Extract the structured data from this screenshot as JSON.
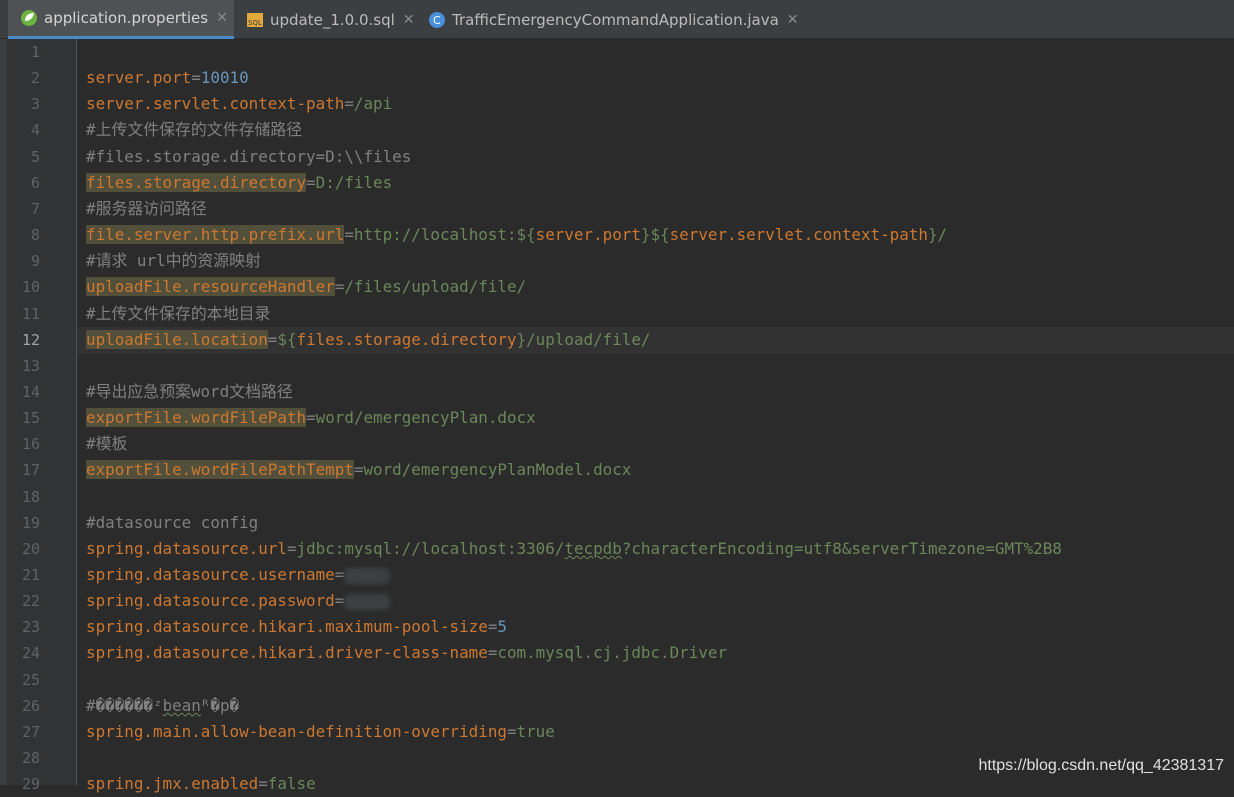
{
  "tabs": [
    {
      "label": "application.properties",
      "icon": "spring-leaf-icon",
      "active": true
    },
    {
      "label": "update_1.0.0.sql",
      "icon": "sql-file-icon",
      "active": false
    },
    {
      "label": "TrafficEmergencyCommandApplication.java",
      "icon": "java-class-icon",
      "active": false
    }
  ],
  "editor": {
    "current_line": 12,
    "line_numbers": [
      "1",
      "2",
      "3",
      "4",
      "5",
      "6",
      "7",
      "8",
      "9",
      "10",
      "11",
      "12",
      "13",
      "14",
      "15",
      "16",
      "17",
      "18",
      "19",
      "20",
      "21",
      "22",
      "23",
      "24",
      "25",
      "26",
      "27",
      "28",
      "29"
    ],
    "lines": [
      {
        "parts": []
      },
      {
        "parts": [
          {
            "t": "server.port",
            "c": "key"
          },
          {
            "t": "=",
            "c": "eq"
          },
          {
            "t": "10010",
            "c": "num"
          }
        ]
      },
      {
        "parts": [
          {
            "t": "server.servlet.context-path",
            "c": "key"
          },
          {
            "t": "=",
            "c": "eq"
          },
          {
            "t": "/api",
            "c": "val"
          }
        ]
      },
      {
        "parts": [
          {
            "t": "#上传文件保存的文件存储路径",
            "c": "com"
          }
        ]
      },
      {
        "parts": [
          {
            "t": "#files.storage.directory=D:\\\\files",
            "c": "com"
          }
        ]
      },
      {
        "parts": [
          {
            "t": "files.storage.directory",
            "c": "key hl"
          },
          {
            "t": "=",
            "c": "eq"
          },
          {
            "t": "D:/files",
            "c": "val"
          }
        ]
      },
      {
        "parts": [
          {
            "t": "#服务器访问路径",
            "c": "com"
          }
        ]
      },
      {
        "parts": [
          {
            "t": "file.server.http.prefix.url",
            "c": "key hl"
          },
          {
            "t": "=",
            "c": "eq"
          },
          {
            "t": "http://localhost:${",
            "c": "val"
          },
          {
            "t": "server.port",
            "c": "ref"
          },
          {
            "t": "}${",
            "c": "val"
          },
          {
            "t": "server.servlet.context-path",
            "c": "ref"
          },
          {
            "t": "}/",
            "c": "val"
          }
        ]
      },
      {
        "parts": [
          {
            "t": "#请求 url中的资源映射",
            "c": "com"
          }
        ]
      },
      {
        "parts": [
          {
            "t": "uploadFile.resourceHandler",
            "c": "key hl"
          },
          {
            "t": "=",
            "c": "eq"
          },
          {
            "t": "/files/upload/file/",
            "c": "val"
          }
        ]
      },
      {
        "parts": [
          {
            "t": "#上传文件保存的本地目录",
            "c": "com"
          }
        ]
      },
      {
        "parts": [
          {
            "t": "uploadFile.location",
            "c": "key hl"
          },
          {
            "t": "=",
            "c": "eq"
          },
          {
            "t": "${",
            "c": "val"
          },
          {
            "t": "files.storage.directory",
            "c": "ref"
          },
          {
            "t": "}/upload/file/",
            "c": "val"
          }
        ]
      },
      {
        "parts": []
      },
      {
        "parts": [
          {
            "t": "#导出应急预案word文档路径",
            "c": "com"
          }
        ]
      },
      {
        "parts": [
          {
            "t": "exportFile.wordFilePath",
            "c": "key hl"
          },
          {
            "t": "=",
            "c": "eq"
          },
          {
            "t": "word/emergencyPlan.docx",
            "c": "val"
          }
        ]
      },
      {
        "parts": [
          {
            "t": "#模板",
            "c": "com"
          }
        ]
      },
      {
        "parts": [
          {
            "t": "exportFile.wordFilePathTempt",
            "c": "key hl"
          },
          {
            "t": "=",
            "c": "eq"
          },
          {
            "t": "word/emergencyPlanModel.docx",
            "c": "val"
          }
        ]
      },
      {
        "parts": []
      },
      {
        "parts": [
          {
            "t": "#datasource config",
            "c": "com"
          }
        ]
      },
      {
        "parts": [
          {
            "t": "spring.datasource.url",
            "c": "key"
          },
          {
            "t": "=",
            "c": "eq"
          },
          {
            "t": "jdbc:mysql://localhost:3306/",
            "c": "val"
          },
          {
            "t": "tecpdb",
            "c": "val squig"
          },
          {
            "t": "?characterEncoding=utf8&serverTimezone=GMT%2B8",
            "c": "val"
          }
        ]
      },
      {
        "parts": [
          {
            "t": "spring.datasource.username",
            "c": "key"
          },
          {
            "t": "=",
            "c": "eq"
          },
          {
            "t": "",
            "c": "blur"
          }
        ]
      },
      {
        "parts": [
          {
            "t": "spring.datasource.password",
            "c": "key"
          },
          {
            "t": "=",
            "c": "eq"
          },
          {
            "t": "",
            "c": "blur"
          }
        ]
      },
      {
        "parts": [
          {
            "t": "spring.datasource.hikari.maximum-pool-size",
            "c": "key"
          },
          {
            "t": "=",
            "c": "eq"
          },
          {
            "t": "5",
            "c": "num"
          }
        ]
      },
      {
        "parts": [
          {
            "t": "spring.datasource.hikari.driver-class-name",
            "c": "key"
          },
          {
            "t": "=",
            "c": "eq"
          },
          {
            "t": "com.mysql.cj.jdbc.Driver",
            "c": "val"
          }
        ]
      },
      {
        "parts": []
      },
      {
        "parts": [
          {
            "t": "#������",
            "c": "com"
          },
          {
            "t": "ᶻ",
            "c": "com"
          },
          {
            "t": "bean",
            "c": "com squig"
          },
          {
            "t": "ᴿ",
            "c": "com"
          },
          {
            "t": "�p�",
            "c": "com"
          }
        ]
      },
      {
        "parts": [
          {
            "t": "spring.main.allow-bean-definition-overriding",
            "c": "key"
          },
          {
            "t": "=",
            "c": "eq"
          },
          {
            "t": "true",
            "c": "val"
          }
        ]
      },
      {
        "parts": []
      },
      {
        "parts": [
          {
            "t": "spring.jmx.enabled",
            "c": "key"
          },
          {
            "t": "=",
            "c": "eq"
          },
          {
            "t": "false",
            "c": "val"
          }
        ]
      }
    ]
  },
  "watermark": "https://blog.csdn.net/qq_42381317",
  "colors": {
    "background": "#2b2b2b",
    "key": "#cc7832",
    "value": "#6a8759",
    "number": "#6897bb",
    "comment": "#808080"
  }
}
